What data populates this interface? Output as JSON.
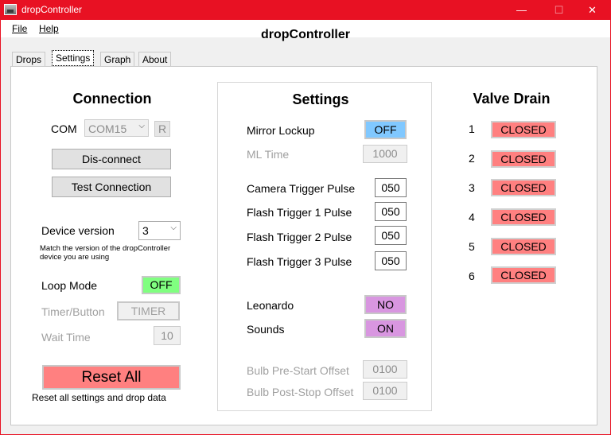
{
  "window": {
    "title": "dropController",
    "minimize": "—",
    "maximize": "☐",
    "close": "✕"
  },
  "menu": {
    "file": "File",
    "help": "Help"
  },
  "app_title": "dropController",
  "tabs": [
    "Drops",
    "Settings",
    "Graph",
    "About"
  ],
  "connection": {
    "heading": "Connection",
    "com_label": "COM",
    "com_value": "COM15",
    "refresh_label": "R",
    "disconnect_label": "Dis-connect",
    "test_label": "Test Connection",
    "device_version_label": "Device version",
    "device_version_value": "3",
    "device_hint": "Match the version of the dropController device you are using",
    "loop_mode_label": "Loop Mode",
    "loop_mode_value": "OFF",
    "timer_button_label": "Timer/Button",
    "timer_button_value": "TIMER",
    "wait_time_label": "Wait Time",
    "wait_time_value": "10",
    "reset_label": "Reset All",
    "reset_hint": "Reset all settings and drop data"
  },
  "settings": {
    "heading": "Settings",
    "mirror_lockup_label": "Mirror Lockup",
    "mirror_lockup_value": "OFF",
    "ml_time_label": "ML Time",
    "ml_time_value": "1000",
    "camera_trigger_label": "Camera Trigger Pulse",
    "camera_trigger_value": "050",
    "flash1_label": "Flash Trigger 1 Pulse",
    "flash1_value": "050",
    "flash2_label": "Flash Trigger 2 Pulse",
    "flash2_value": "050",
    "flash3_label": "Flash Trigger 3 Pulse",
    "flash3_value": "050",
    "leonardo_label": "Leonardo",
    "leonardo_value": "NO",
    "sounds_label": "Sounds",
    "sounds_value": "ON",
    "bulb_pre_label": "Bulb Pre-Start Offset",
    "bulb_pre_value": "0100",
    "bulb_post_label": "Bulb Post-Stop Offset",
    "bulb_post_value": "0100"
  },
  "valve_drain": {
    "heading": "Valve Drain",
    "valves": [
      {
        "num": "1",
        "state": "CLOSED"
      },
      {
        "num": "2",
        "state": "CLOSED"
      },
      {
        "num": "3",
        "state": "CLOSED"
      },
      {
        "num": "4",
        "state": "CLOSED"
      },
      {
        "num": "5",
        "state": "CLOSED"
      },
      {
        "num": "6",
        "state": "CLOSED"
      }
    ]
  },
  "colors": {
    "title_bar": "#e81123",
    "toggle_off_green": "#80ff80",
    "toggle_blue": "#80c8ff",
    "toggle_purple": "#d896e0",
    "reset_red": "#ff8080",
    "valve_red": "#ff8080"
  }
}
